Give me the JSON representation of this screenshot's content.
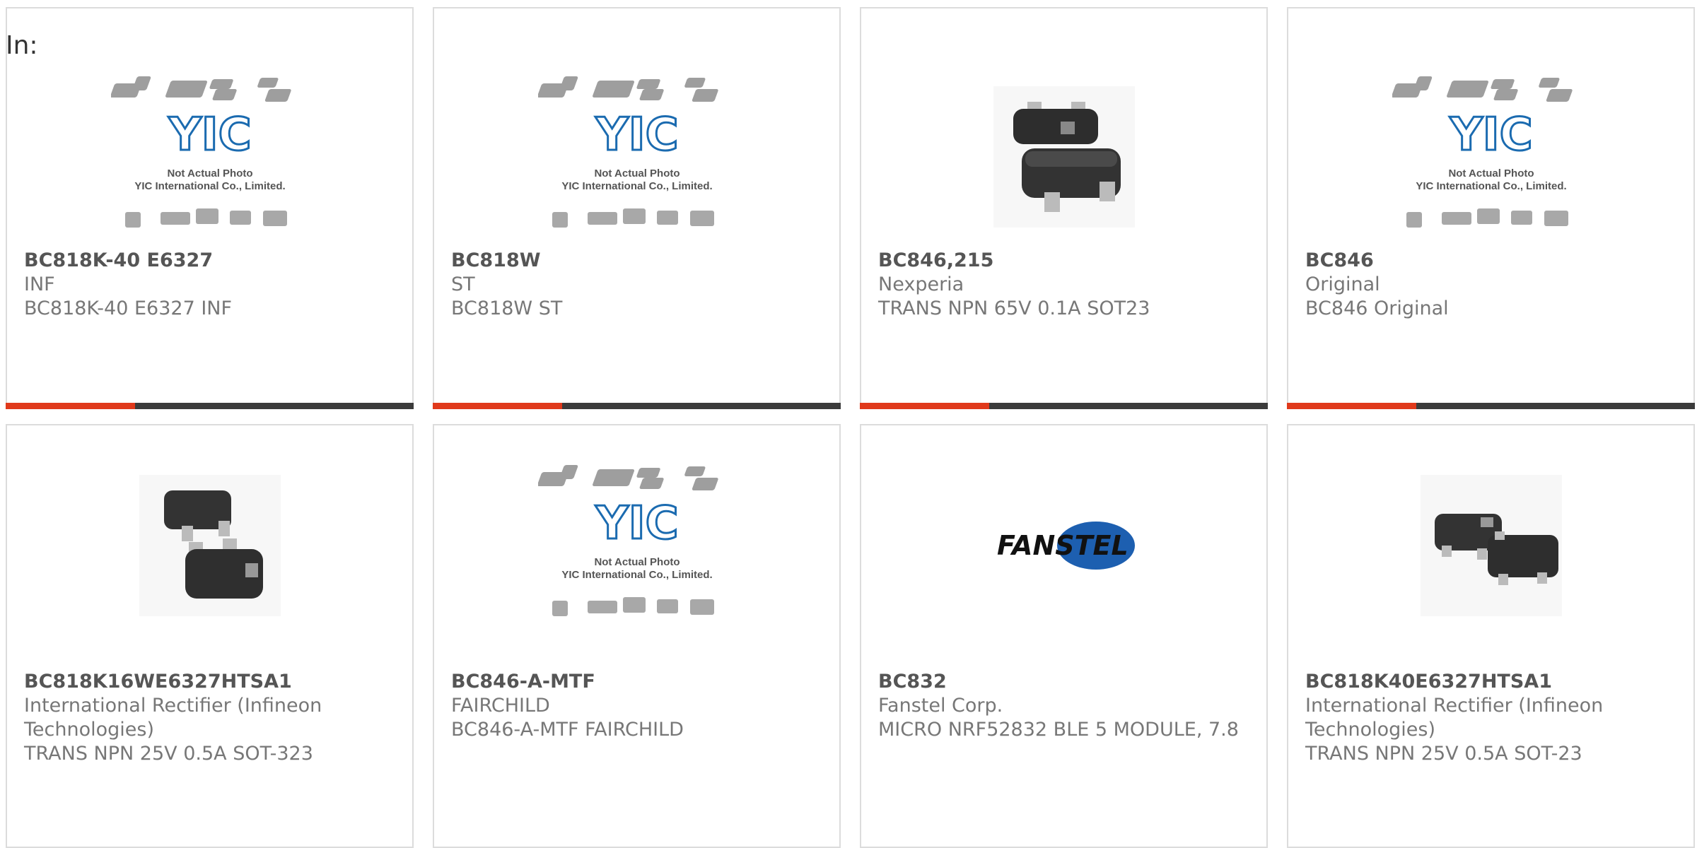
{
  "filter": {
    "label": "In:"
  },
  "placeholder_image": {
    "line1": "Not Actual Photo",
    "line2": "YIC International Co., Limited.",
    "logo": "YIC"
  },
  "colors": {
    "accent": "#e0391b",
    "bar": "#3b3b3b",
    "border": "#dcdcdc"
  },
  "products": [
    {
      "part": "BC818K-40 E6327",
      "manufacturer": "INF",
      "description": "BC818K-40 E6327 INF",
      "image": "placeholder-photo"
    },
    {
      "part": "BC818W",
      "manufacturer": "ST",
      "description": "BC818W ST",
      "image": "placeholder-photo"
    },
    {
      "part": "BC846,215",
      "manufacturer": "Nexperia",
      "description": "TRANS NPN 65V 0.1A SOT23",
      "image": "sot23-photo"
    },
    {
      "part": "BC846",
      "manufacturer": "Original",
      "description": "BC846 Original",
      "image": "placeholder-photo"
    },
    {
      "part": "BC818K16WE6327HTSA1",
      "manufacturer": "International Rectifier (Infineon Technologies)",
      "description": "TRANS NPN 25V 0.5A SOT-323",
      "image": "sot323-photo"
    },
    {
      "part": "BC846-A-MTF",
      "manufacturer": "FAIRCHILD",
      "description": "BC846-A-MTF FAIRCHILD",
      "image": "placeholder-photo"
    },
    {
      "part": "BC832",
      "manufacturer": "Fanstel Corp.",
      "description": "MICRO NRF52832 BLE 5 MODULE, 7.8",
      "image": "fanstel-logo",
      "logo_text": "FANSTEL"
    },
    {
      "part": "BC818K40E6327HTSA1",
      "manufacturer": "International Rectifier (Infineon Technologies)",
      "description": "TRANS NPN 25V 0.5A SOT-23",
      "image": "sot23-pair-photo"
    }
  ]
}
